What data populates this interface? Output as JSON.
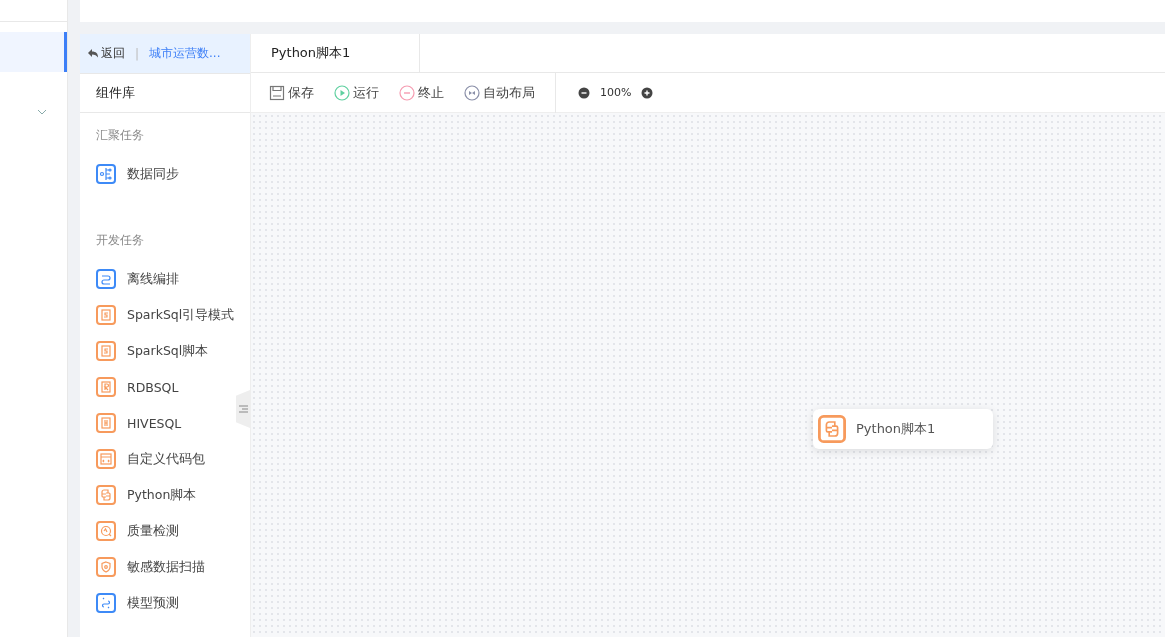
{
  "nav": {
    "items": [
      {
        "selected": true
      },
      {
        "selected": false,
        "expandable": true
      }
    ]
  },
  "back": {
    "label": "返回",
    "separator": "|",
    "project": "城市运营数..."
  },
  "panel_title": "组件库",
  "groups": [
    {
      "title": "汇聚任务",
      "items": [
        {
          "label": "数据同步",
          "kind": "sync",
          "color": "#3d8af7"
        }
      ]
    },
    {
      "title": "开发任务",
      "items": [
        {
          "label": "离线编排",
          "kind": "flow",
          "color": "#3d8af7"
        },
        {
          "label": "SparkSql引导模式",
          "kind": "s",
          "color": "#f79a5c"
        },
        {
          "label": "SparkSql脚本",
          "kind": "s",
          "color": "#f79a5c"
        },
        {
          "label": "RDBSQL",
          "kind": "r",
          "color": "#f79a5c"
        },
        {
          "label": "HIVESQL",
          "kind": "h",
          "color": "#f79a5c"
        },
        {
          "label": "自定义代码包",
          "kind": "code",
          "color": "#f79a5c"
        },
        {
          "label": "Python脚本",
          "kind": "python",
          "color": "#f79a5c"
        },
        {
          "label": "质量检测",
          "kind": "quality",
          "color": "#f79a5c"
        },
        {
          "label": "敏感数据扫描",
          "kind": "shield",
          "color": "#f79a5c"
        },
        {
          "label": "模型预测",
          "kind": "model",
          "color": "#3d8af7"
        }
      ]
    }
  ],
  "tabs": [
    {
      "label": "Python脚本1",
      "selected": true
    }
  ],
  "toolbar": [
    {
      "label": "保存",
      "kind": "save"
    },
    {
      "label": "运行",
      "kind": "run"
    },
    {
      "label": "终止",
      "kind": "stop"
    },
    {
      "label": "自动布局",
      "kind": "layout"
    }
  ],
  "zoom": "100%",
  "nodes": [
    {
      "label": "Python脚本1",
      "kind": "python",
      "color": "#f79a5c"
    }
  ]
}
